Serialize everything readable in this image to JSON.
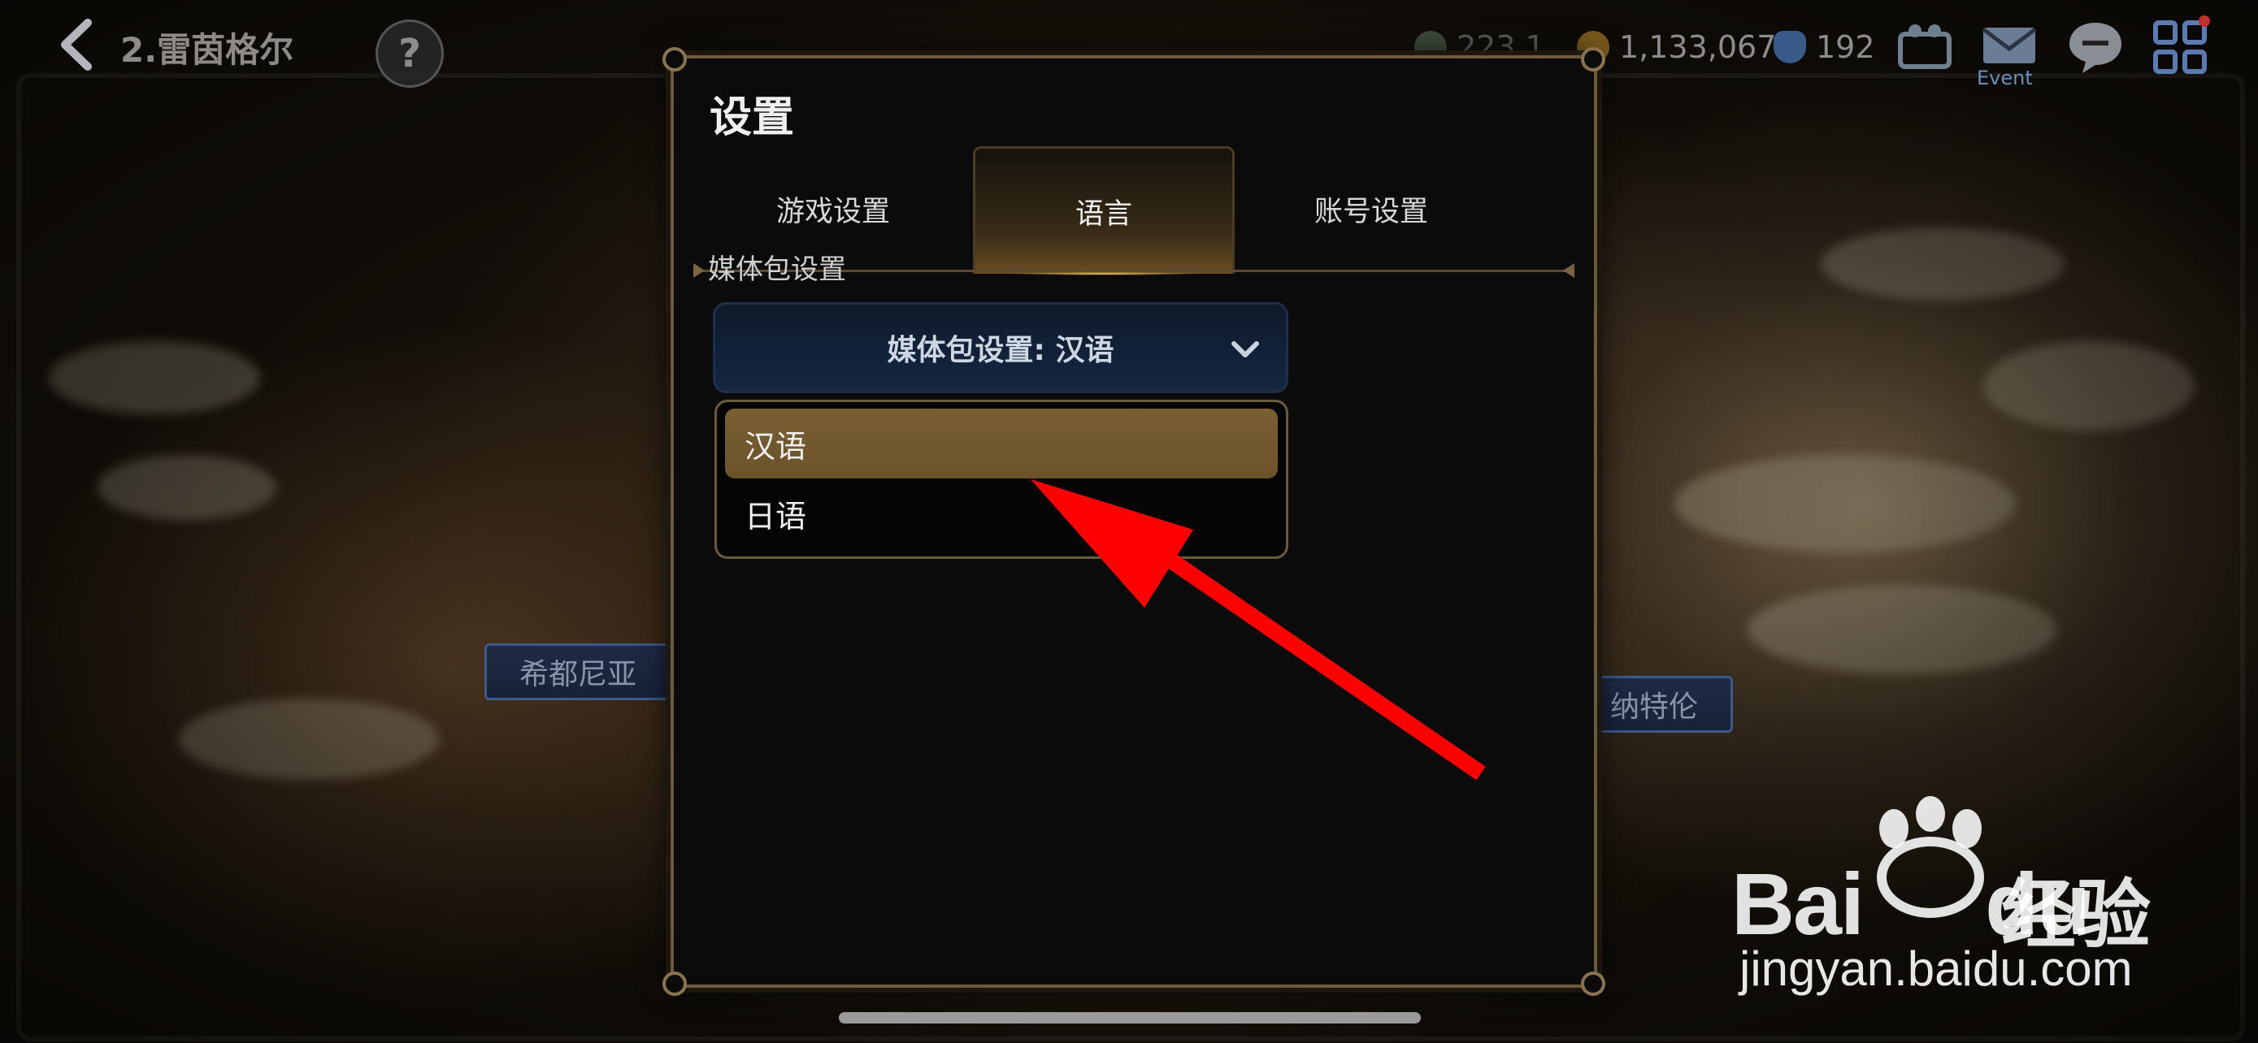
{
  "topbar": {
    "title": "2.雷茵格尔",
    "help": "?",
    "currency_1": "223,1",
    "currency_2": "1,133,067",
    "currency_3": "192",
    "event_label": "Event"
  },
  "map": {
    "label_left": "希都尼亚",
    "label_right": "纳特伦"
  },
  "settings": {
    "title": "设置",
    "tabs": [
      {
        "label": "游戏设置",
        "active": false
      },
      {
        "label": "语言",
        "active": true
      },
      {
        "label": "账号设置",
        "active": false
      }
    ],
    "section_label": "媒体包设置",
    "dropdown_value": "媒体包设置: 汉语",
    "options": [
      {
        "label": "汉语",
        "selected": true
      },
      {
        "label": "日语",
        "selected": false
      }
    ]
  },
  "watermark": {
    "brand": "Bai",
    "brand_du": "du",
    "jingyan": "经验",
    "url": "jingyan.baidu.com"
  },
  "colors": {
    "accent_gold": "#6b5229",
    "panel_border": "#6b5a3e",
    "annotation_arrow": "#ff0000"
  }
}
